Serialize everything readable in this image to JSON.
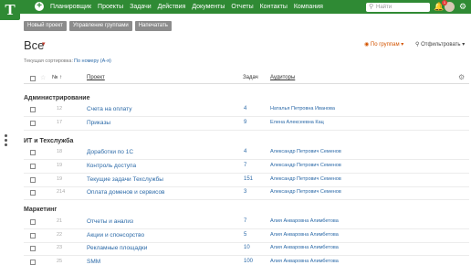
{
  "header": {
    "logo": "T",
    "nav": [
      "Планировщик",
      "Проекты",
      "Задачи",
      "Действия",
      "Документы",
      "Отчеты",
      "Контакты",
      "Компания"
    ],
    "search_placeholder": "Найти",
    "notification_count": "1"
  },
  "toolbar": {
    "new_project": "Новый проект",
    "group_management": "Управление группами",
    "print": "Напечатать"
  },
  "page": {
    "title": "Все",
    "group_by": "По группам",
    "filter": "Отфильтровать",
    "sort_label": "Текущая сортировка:",
    "sort_value": "По номеру (А-я)"
  },
  "table": {
    "headers": {
      "num": "№",
      "project": "Проект",
      "tasks": "Задач",
      "auditors": "Аудиторы"
    },
    "groups": [
      {
        "name": "Администрирование",
        "rows": [
          {
            "num": "12",
            "name": "Счета на оплату",
            "tasks": "4",
            "auditor": "Наталья Петровна Иванова"
          },
          {
            "num": "17",
            "name": "Приказы",
            "tasks": "9",
            "auditor": "Елена Алексеевна Кац"
          }
        ]
      },
      {
        "name": "ИТ и Техслужба",
        "rows": [
          {
            "num": "18",
            "name": "Доработки по 1С",
            "tasks": "4",
            "auditor": "Александр Петрович Семенов"
          },
          {
            "num": "19",
            "name": "Контроль доступа",
            "tasks": "7",
            "auditor": "Александр Петрович Семенов"
          },
          {
            "num": "19",
            "name": "Текущие задачи Техслужбы",
            "tasks": "151",
            "auditor": "Александр Петрович Семенов"
          },
          {
            "num": "214",
            "name": "Оплата доменов и сервисов",
            "tasks": "3",
            "auditor": "Александр Петрович Семенов"
          }
        ]
      },
      {
        "name": "Маркетинг",
        "rows": [
          {
            "num": "21",
            "name": "Отчеты и анализ",
            "tasks": "7",
            "auditor": "Алия Анваровна Алимбетова"
          },
          {
            "num": "22",
            "name": "Акции и спонсорство",
            "tasks": "5",
            "auditor": "Алия Анваровна Алимбетова"
          },
          {
            "num": "23",
            "name": "Рекламные площадки",
            "tasks": "10",
            "auditor": "Алия Анваровна Алимбетова"
          },
          {
            "num": "25",
            "name": "SMM",
            "tasks": "100",
            "auditor": "Алия Анваровна Алимбетова"
          }
        ]
      }
    ]
  }
}
